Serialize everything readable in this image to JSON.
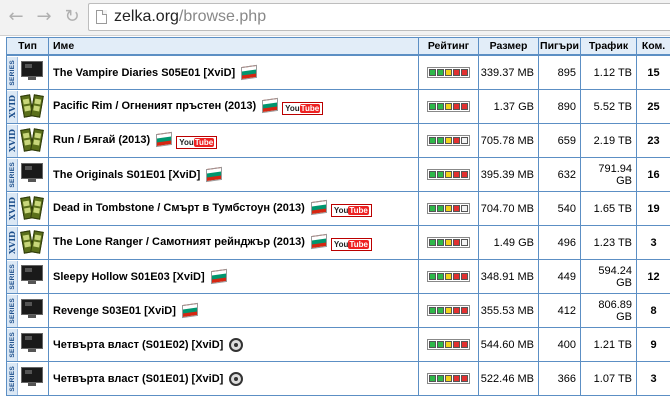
{
  "browser": {
    "url_host": "zelka.org",
    "url_path": "/browse.php",
    "back_icon": "arrow-left-icon",
    "forward_icon": "arrow-right-icon",
    "reload_icon": "reload-icon"
  },
  "colors": {
    "header_bg": "#e2edf8",
    "border": "#5c8fc4",
    "rating_green": "#2fb84a",
    "rating_yellow": "#f2d21b",
    "rating_red": "#e23030",
    "rating_empty": "#f2f2f2"
  },
  "table": {
    "headers": {
      "type": "Тип",
      "name": "Име",
      "rating": "Рейтинг",
      "size": "Размер",
      "seeders": "Пигъри",
      "traffic": "Трафик",
      "comments": "Ком."
    },
    "rows": [
      {
        "category": "SERIES",
        "name": "The Vampire Diaries S05E01 [XviD]",
        "flag": true,
        "youtube": false,
        "film_reel": false,
        "rating": [
          "green",
          "green",
          "yellow",
          "red",
          "red"
        ],
        "size": "339.37 MB",
        "seeders": "895",
        "traffic": "1.12 TB",
        "comments": "15"
      },
      {
        "category": "XVID",
        "name": "Pacific Rim / Огненият пръстен (2013)",
        "flag": true,
        "youtube": true,
        "film_reel": false,
        "rating": [
          "green",
          "green",
          "yellow",
          "red",
          "red"
        ],
        "size": "1.37 GB",
        "seeders": "890",
        "traffic": "5.52 TB",
        "comments": "25"
      },
      {
        "category": "XVID",
        "name": "Run / Бягай (2013)",
        "flag": true,
        "youtube": true,
        "film_reel": false,
        "rating": [
          "green",
          "green",
          "yellow",
          "red",
          "empty"
        ],
        "size": "705.78 MB",
        "seeders": "659",
        "traffic": "2.19 TB",
        "comments": "23"
      },
      {
        "category": "SERIES",
        "name": "The Originals S01E01 [XviD]",
        "flag": true,
        "youtube": false,
        "film_reel": false,
        "rating": [
          "green",
          "green",
          "yellow",
          "red",
          "red"
        ],
        "size": "395.39 MB",
        "seeders": "632",
        "traffic": "791.94 GB",
        "comments": "16"
      },
      {
        "category": "XVID",
        "name": "Dead in Tombstone / Смърт в Тумбстоун (2013)",
        "flag": true,
        "youtube": true,
        "film_reel": false,
        "rating": [
          "green",
          "green",
          "yellow",
          "red",
          "empty"
        ],
        "size": "704.70 MB",
        "seeders": "540",
        "traffic": "1.65 TB",
        "comments": "19"
      },
      {
        "category": "XVID",
        "name": "The Lone Ranger / Самотният рейнджър (2013)",
        "flag": true,
        "youtube": true,
        "film_reel": false,
        "rating": [
          "green",
          "green",
          "yellow",
          "red",
          "empty"
        ],
        "size": "1.49 GB",
        "seeders": "496",
        "traffic": "1.23 TB",
        "comments": "3"
      },
      {
        "category": "SERIES",
        "name": "Sleepy Hollow S01E03 [XviD]",
        "flag": true,
        "youtube": false,
        "film_reel": false,
        "rating": [
          "green",
          "green",
          "yellow",
          "red",
          "red"
        ],
        "size": "348.91 MB",
        "seeders": "449",
        "traffic": "594.24 GB",
        "comments": "12"
      },
      {
        "category": "SERIES",
        "name": "Revenge S03E01 [XviD]",
        "flag": true,
        "youtube": false,
        "film_reel": false,
        "rating": [
          "green",
          "green",
          "yellow",
          "red",
          "red"
        ],
        "size": "355.53 MB",
        "seeders": "412",
        "traffic": "806.89 GB",
        "comments": "8"
      },
      {
        "category": "SERIES",
        "name": "Четвърта власт (S01E02) [XviD]",
        "flag": false,
        "youtube": false,
        "film_reel": true,
        "rating": [
          "green",
          "green",
          "yellow",
          "red",
          "red"
        ],
        "size": "544.60 MB",
        "seeders": "400",
        "traffic": "1.21 TB",
        "comments": "9"
      },
      {
        "category": "SERIES",
        "name": "Четвърта власт (S01E01) [XviD]",
        "flag": false,
        "youtube": false,
        "film_reel": true,
        "rating": [
          "green",
          "green",
          "yellow",
          "red",
          "red"
        ],
        "size": "522.46 MB",
        "seeders": "366",
        "traffic": "1.07 TB",
        "comments": "3"
      }
    ]
  }
}
